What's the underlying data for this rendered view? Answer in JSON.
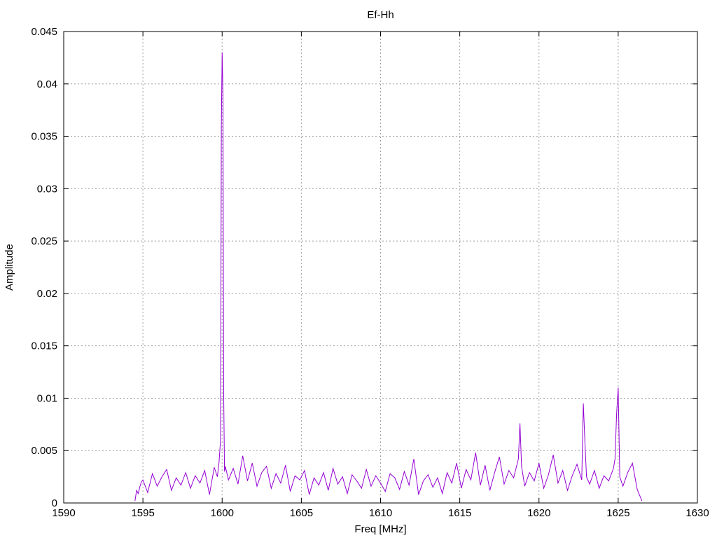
{
  "chart_data": {
    "type": "line",
    "title": "Ef-Hh",
    "xlabel": "Freq [MHz]",
    "ylabel": "Amplitude",
    "xlim": [
      1590,
      1630
    ],
    "ylim": [
      0,
      0.045
    ],
    "xticks": [
      1590,
      1595,
      1600,
      1605,
      1610,
      1615,
      1620,
      1625,
      1630
    ],
    "yticks": [
      0,
      0.005,
      0.01,
      0.015,
      0.02,
      0.025,
      0.03,
      0.035,
      0.04,
      0.045
    ],
    "xtick_labels": [
      "1590",
      "1595",
      "1600",
      "1605",
      "1610",
      "1615",
      "1620",
      "1625",
      "1630"
    ],
    "ytick_labels": [
      "0",
      "0.005",
      "0.01",
      "0.015",
      "0.02",
      "0.025",
      "0.03",
      "0.035",
      "0.04",
      "0.045"
    ],
    "grid": true,
    "line_color": "#9400d3",
    "series": [
      {
        "x": [
          1594.5,
          1594.6,
          1594.7,
          1594.8,
          1594.9,
          1595.0,
          1595.3,
          1595.6,
          1595.9,
          1596.2,
          1596.5,
          1596.8,
          1597.1,
          1597.4,
          1597.7,
          1598.0,
          1598.3,
          1598.6,
          1598.9,
          1599.2,
          1599.5,
          1599.7,
          1599.8,
          1599.9,
          1599.95,
          1600.0,
          1600.05,
          1600.1,
          1600.15,
          1600.2,
          1600.4,
          1600.7,
          1601.0,
          1601.3,
          1601.6,
          1601.9,
          1602.2,
          1602.5,
          1602.8,
          1603.1,
          1603.4,
          1603.7,
          1604.0,
          1604.3,
          1604.6,
          1604.9,
          1605.2,
          1605.5,
          1605.8,
          1606.1,
          1606.4,
          1606.7,
          1607.0,
          1607.3,
          1607.6,
          1607.9,
          1608.2,
          1608.5,
          1608.8,
          1609.1,
          1609.4,
          1609.7,
          1610.0,
          1610.3,
          1610.6,
          1610.9,
          1611.2,
          1611.5,
          1611.8,
          1612.1,
          1612.4,
          1612.7,
          1613.0,
          1613.3,
          1613.6,
          1613.9,
          1614.2,
          1614.5,
          1614.8,
          1615.1,
          1615.4,
          1615.7,
          1616.0,
          1616.3,
          1616.6,
          1616.9,
          1617.2,
          1617.5,
          1617.8,
          1618.1,
          1618.4,
          1618.7,
          1618.8,
          1618.9,
          1619.1,
          1619.4,
          1619.7,
          1620.0,
          1620.3,
          1620.6,
          1620.9,
          1621.2,
          1621.5,
          1621.8,
          1622.1,
          1622.4,
          1622.7,
          1622.8,
          1622.9,
          1623.0,
          1623.2,
          1623.5,
          1623.8,
          1624.1,
          1624.4,
          1624.7,
          1624.8,
          1624.9,
          1625.0,
          1625.1,
          1625.3,
          1625.6,
          1625.9,
          1626.2,
          1626.5
        ],
        "y": [
          0.0002,
          0.0012,
          0.0009,
          0.0015,
          0.002,
          0.0022,
          0.001,
          0.0028,
          0.0016,
          0.0025,
          0.0032,
          0.0012,
          0.0024,
          0.0017,
          0.0029,
          0.0014,
          0.0026,
          0.0019,
          0.0031,
          0.0008,
          0.0034,
          0.0025,
          0.0038,
          0.006,
          0.036,
          0.043,
          0.039,
          0.01,
          0.003,
          0.0035,
          0.0022,
          0.0033,
          0.0018,
          0.0045,
          0.0021,
          0.0038,
          0.0016,
          0.0029,
          0.0035,
          0.0014,
          0.0028,
          0.0019,
          0.0036,
          0.0011,
          0.0026,
          0.0022,
          0.0031,
          0.0008,
          0.0024,
          0.0017,
          0.0029,
          0.0012,
          0.0033,
          0.0018,
          0.0025,
          0.0009,
          0.0027,
          0.0021,
          0.0014,
          0.0032,
          0.0016,
          0.0026,
          0.0019,
          0.0011,
          0.0028,
          0.0024,
          0.0013,
          0.003,
          0.0017,
          0.0042,
          0.0008,
          0.0021,
          0.0027,
          0.0015,
          0.0024,
          0.0009,
          0.0029,
          0.0019,
          0.0038,
          0.0014,
          0.0032,
          0.0022,
          0.0048,
          0.0017,
          0.0036,
          0.0012,
          0.0029,
          0.0044,
          0.0018,
          0.0031,
          0.0024,
          0.0042,
          0.0076,
          0.0035,
          0.0016,
          0.0029,
          0.0021,
          0.0038,
          0.0014,
          0.0027,
          0.0046,
          0.0019,
          0.0031,
          0.0012,
          0.0026,
          0.0037,
          0.0022,
          0.0095,
          0.0058,
          0.0025,
          0.0018,
          0.0031,
          0.0014,
          0.0026,
          0.0021,
          0.0033,
          0.0042,
          0.0085,
          0.011,
          0.0025,
          0.0016,
          0.0029,
          0.0038,
          0.0013,
          0.0002
        ]
      }
    ]
  }
}
